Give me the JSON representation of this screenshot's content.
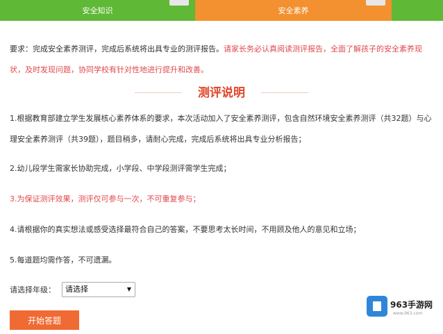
{
  "tabs": [
    {
      "label": "安全知识"
    },
    {
      "label": "安全素养"
    },
    {
      "label": ""
    }
  ],
  "requirement": {
    "normal": "要求：完成安全素养测评，完成后系统将出具专业的测评报告。",
    "red": "请家长务必认真阅读测评报告，全面了解孩子的安全素养现状，及时发现问题，协同学校有针对性地进行提升和改善。"
  },
  "title": "测评说明",
  "paragraphs": [
    "1.根据教育部建立学生发展核心素养体系的要求，本次活动加入了安全素养测评，包含自然环境安全素养测评（共32题）与心理安全素养测评（共39题），题目稍多，请耐心完成，完成后系统将出具专业分析报告；",
    "2.幼儿段学生需家长协助完成，小学段、中学段测评需学生完成；",
    "3.为保证测评效果，测评仅可参与一次，不可重复参与；",
    "4.请根据你的真实想法或感受选择最符合自己的答案，不要思考太长时间，不用顾及他人的意见和立场；",
    "5.每道题均需作答，不可遗漏。"
  ],
  "grade": {
    "label": "请选择年级：",
    "selected": "请选择"
  },
  "start_button": "开始答题",
  "watermark": {
    "name": "963手游网",
    "url": "www.963.com"
  },
  "colors": {
    "tab_green": "#5fb836",
    "tab_orange": "#f3902f",
    "title_red": "#e0452a",
    "notice_red": "#e2474c",
    "button_orange": "#f06a33"
  }
}
